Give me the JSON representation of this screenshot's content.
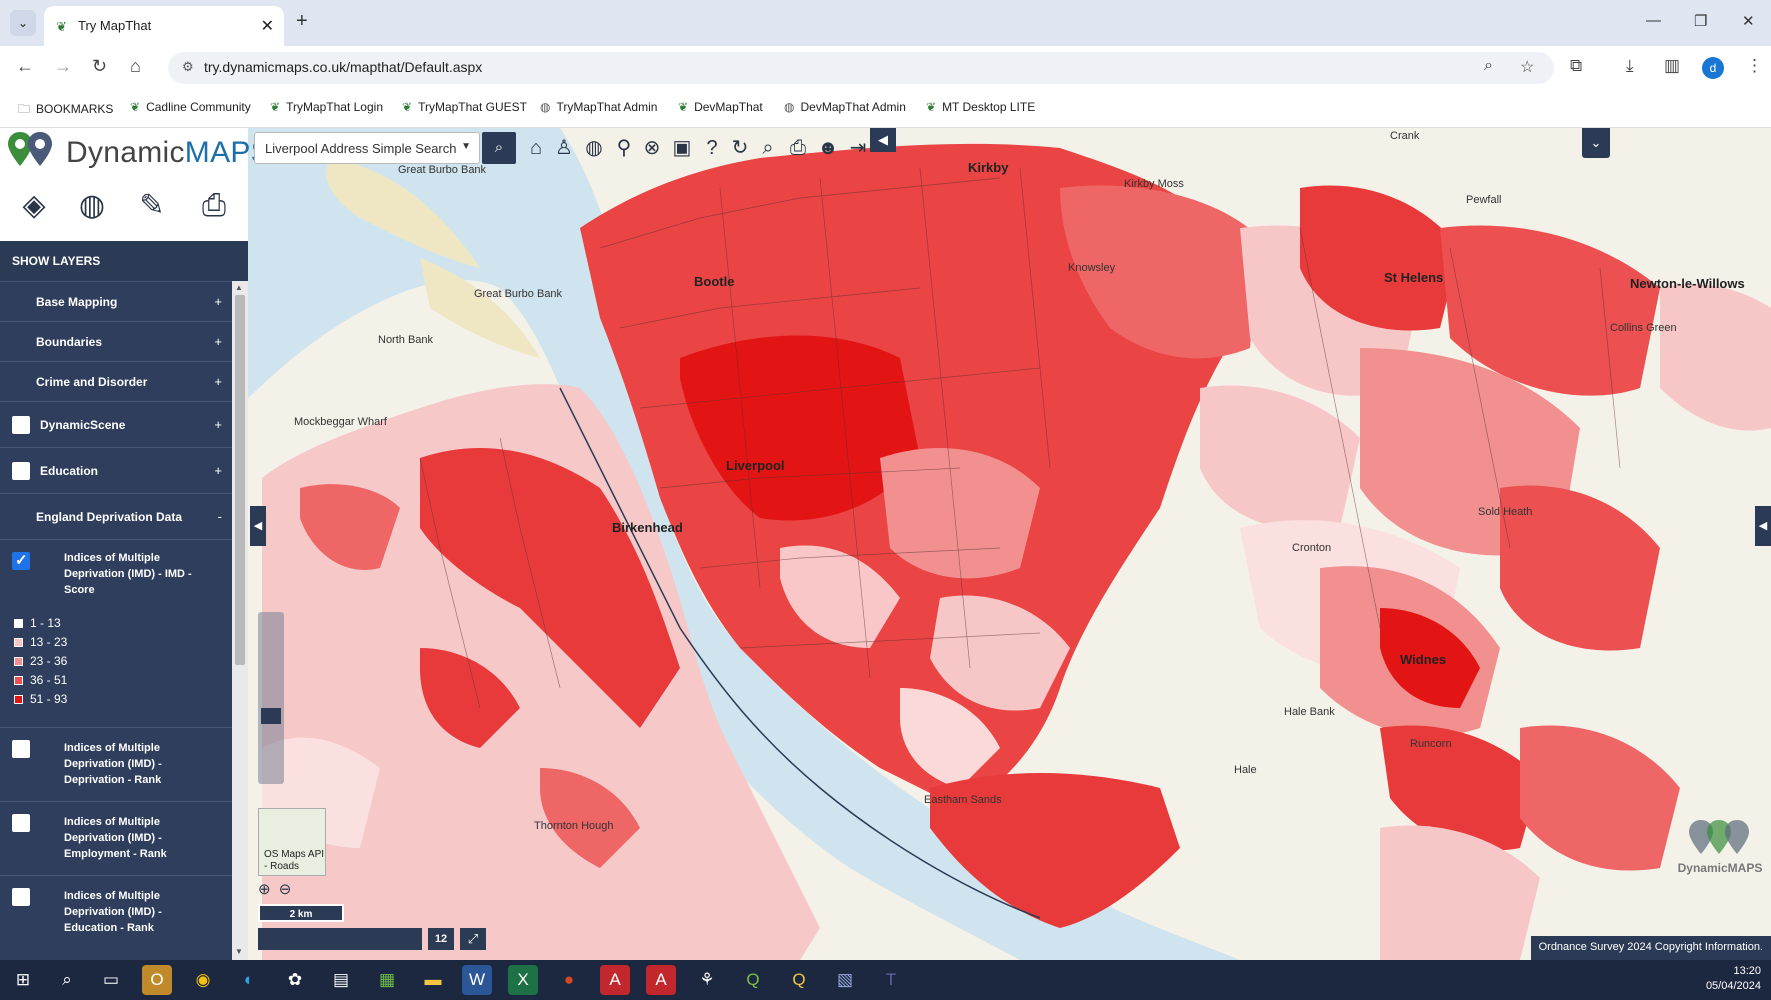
{
  "browser": {
    "tab_title": "Try MapThat",
    "url": "try.dynamicmaps.co.uk/mapthat/Default.aspx",
    "bookmarks": [
      "BOOKMARKS",
      "Cadline Community",
      "TryMapThat Login",
      "TryMapThat GUEST",
      "TryMapThat Admin",
      "DevMapThat",
      "DevMapThat Admin",
      "MT Desktop LITE"
    ],
    "profile_initial": "d"
  },
  "app": {
    "logo_prefix": "Dynamic",
    "logo_suffix": "MAPS",
    "search_selector": "Liverpool Address Simple Search"
  },
  "layers_panel": {
    "title": "SHOW LAYERS",
    "groups": [
      {
        "label": "Base Mapping",
        "toggle": "+"
      },
      {
        "label": "Boundaries",
        "toggle": "+"
      },
      {
        "label": "Crime and Disorder",
        "toggle": "+"
      },
      {
        "label": "DynamicScene",
        "toggle": "+"
      },
      {
        "label": "Education",
        "toggle": "+"
      },
      {
        "label": "England Deprivation Data",
        "toggle": "-"
      }
    ],
    "sublayers": [
      {
        "label": "Indices of Multiple Deprivation (IMD) - IMD - Score",
        "checked": true
      },
      {
        "label": "Indices of Multiple Deprivation (IMD) - Deprivation - Rank",
        "checked": false
      },
      {
        "label": "Indices of Multiple Deprivation (IMD) - Employment - Rank",
        "checked": false
      },
      {
        "label": "Indices of Multiple Deprivation (IMD) - Education - Rank",
        "checked": false
      }
    ],
    "legend": [
      {
        "label": "1 - 13",
        "color": "#ffffff"
      },
      {
        "label": "13 - 23",
        "color": "#f7c6c6"
      },
      {
        "label": "23 - 36",
        "color": "#f29090"
      },
      {
        "label": "36 - 51",
        "color": "#ec5050"
      },
      {
        "label": "51 - 93",
        "color": "#e31414"
      }
    ]
  },
  "map": {
    "places": [
      "Great Burbo Bank",
      "Great Burbo Bank",
      "North Bank",
      "Mockbeggar Wharf",
      "Birkenhead",
      "Kirkby",
      "Kirkby Moss",
      "St Helens",
      "Newton-le-Willows",
      "Collins Green",
      "Sold Heath",
      "Cronton",
      "Widnes",
      "Hale Bank",
      "Hale",
      "Eastham Sands",
      "Thornton Hough",
      "Runcorn",
      "Pewfall",
      "Crank",
      "Knowsley",
      "Bootle",
      "Liverpool"
    ],
    "scale_label": "2 km",
    "zoom_level": "12",
    "minimap_label": "OS Maps API - Roads",
    "copyright": "Ordnance Survey 2024 Copyright Information.",
    "watermark": "DynamicMAPS"
  },
  "taskbar": {
    "time": "13:20",
    "date": "05/04/2024"
  }
}
